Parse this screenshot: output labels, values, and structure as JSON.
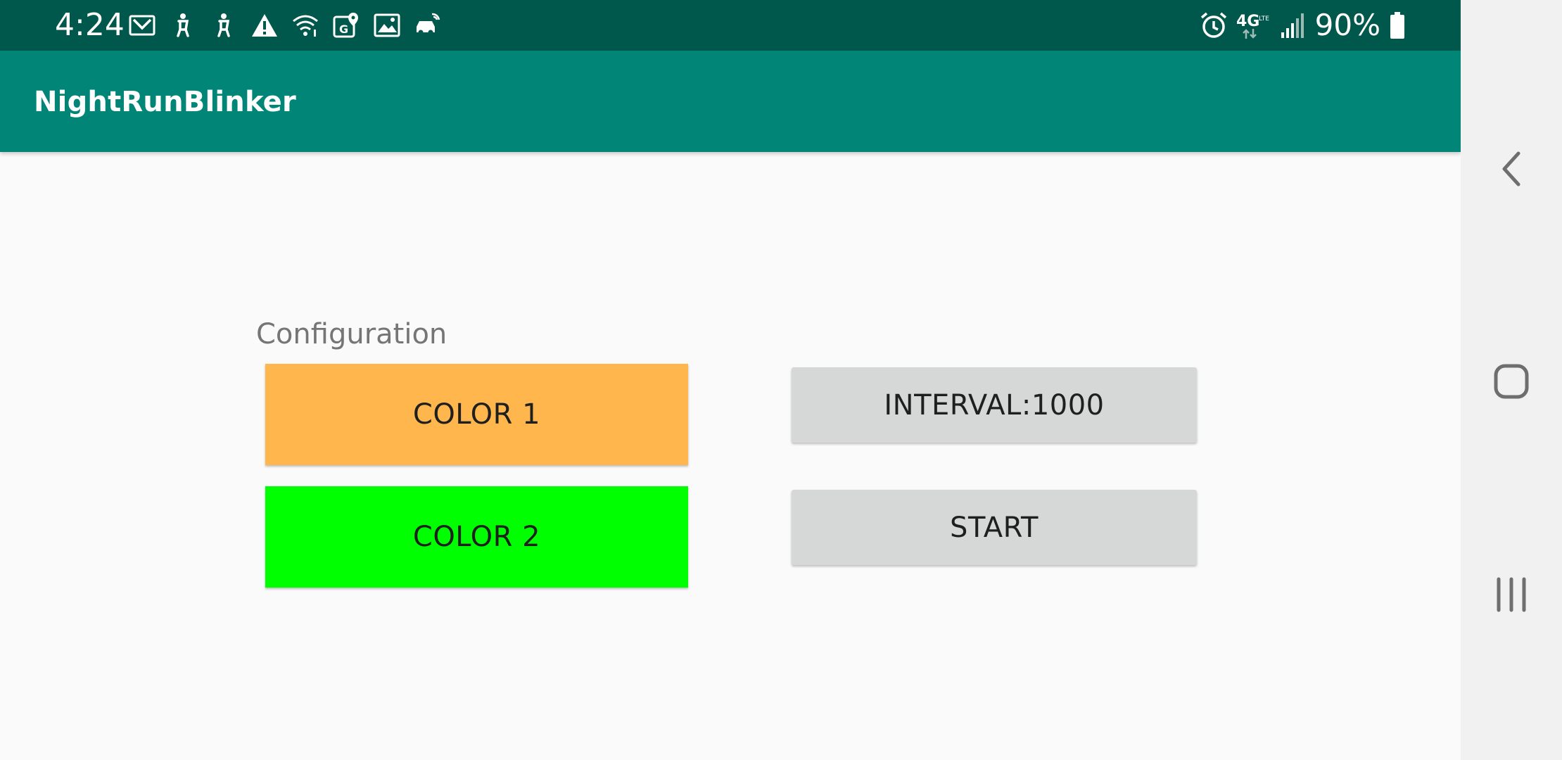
{
  "status_bar": {
    "time": "4:24",
    "battery": "90%",
    "left_icons": [
      "gmail-icon",
      "accessibility-icon",
      "accessibility-icon",
      "warning-icon",
      "wifi-icon",
      "maps-icon",
      "gallery-icon",
      "car-icon"
    ],
    "right_icons": [
      "alarm-icon",
      "4g-lte-icon",
      "signal-icon",
      "battery-icon"
    ],
    "colors": {
      "background": "#00574b",
      "foreground": "#ffffff"
    }
  },
  "app_bar": {
    "title": "NightRunBlinker",
    "color": "#008577"
  },
  "main": {
    "section_label": "Configuration",
    "color1_button": {
      "label": "COLOR 1",
      "color": "#ffb74d"
    },
    "color2_button": {
      "label": "COLOR 2",
      "color": "#00ff00"
    },
    "interval_button": {
      "label": "INTERVAL:1000"
    },
    "start_button": {
      "label": "START"
    }
  },
  "nav_bar": {
    "items": [
      "back-icon",
      "home-icon",
      "recents-icon"
    ]
  }
}
